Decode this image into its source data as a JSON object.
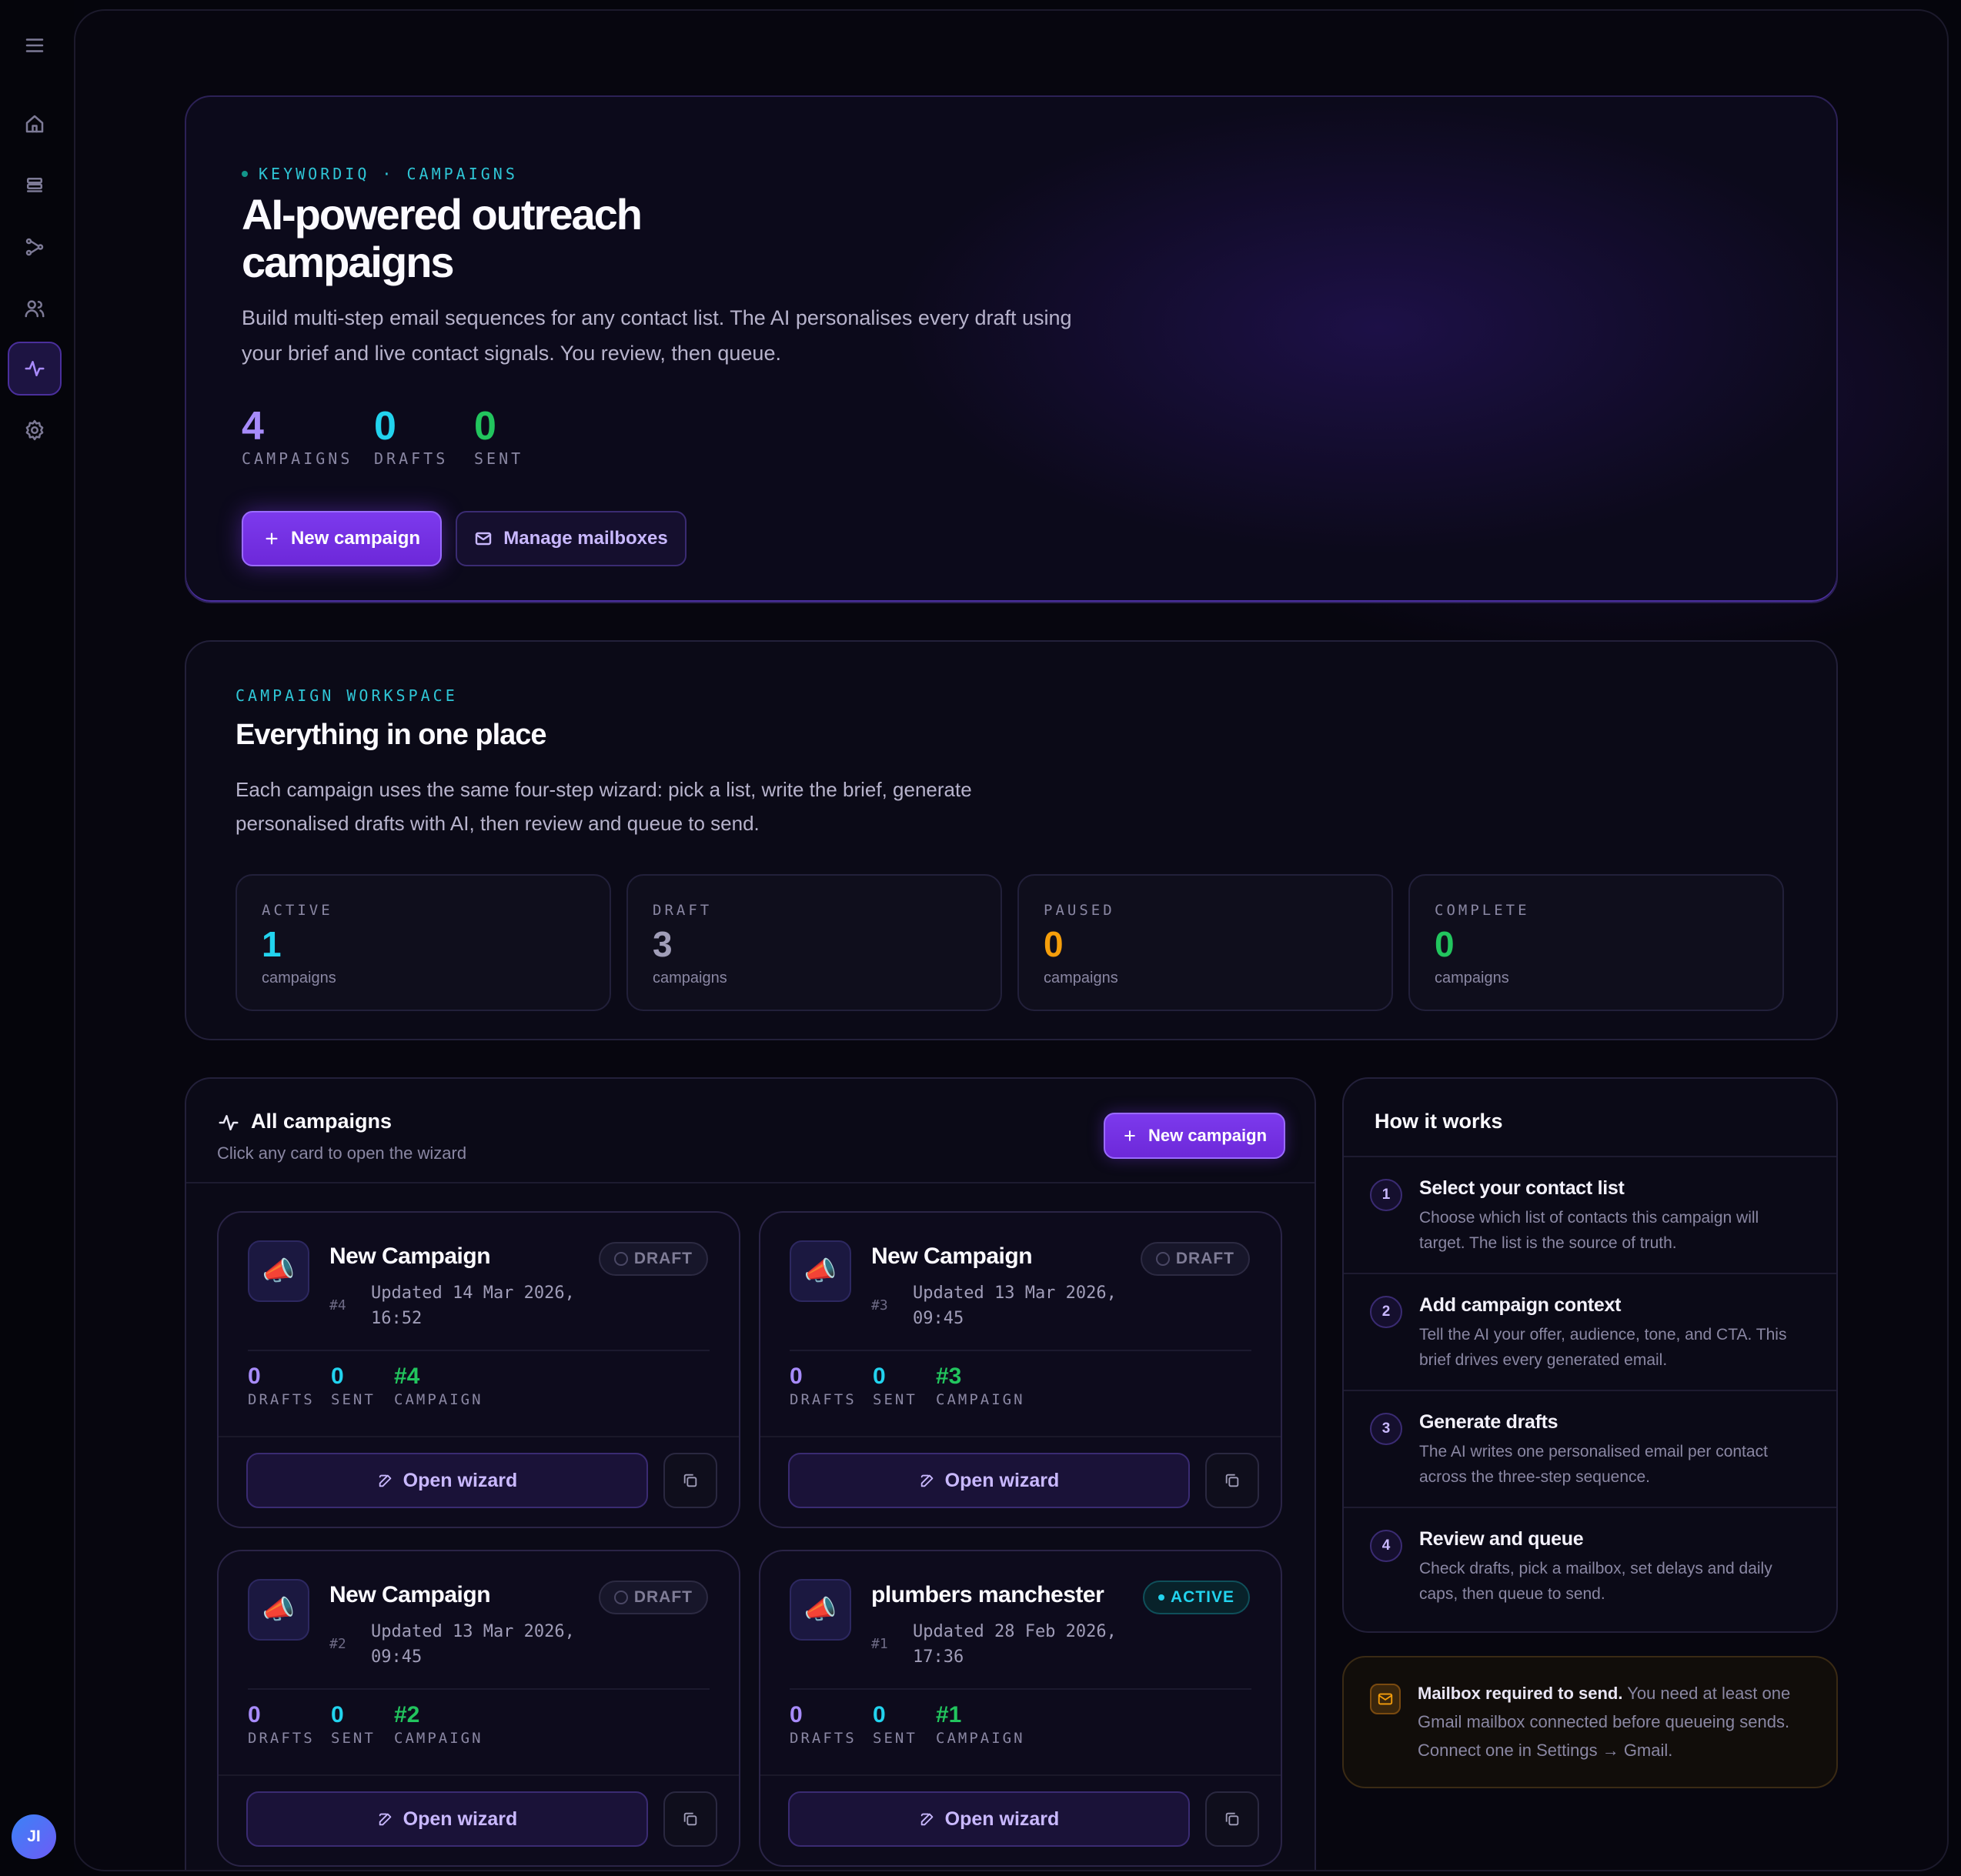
{
  "sidebar": {
    "items": [
      "menu",
      "home",
      "lists",
      "workflow",
      "contacts",
      "campaigns",
      "settings"
    ],
    "active": "campaigns",
    "avatar_initials": "JI"
  },
  "hero": {
    "eyebrow": "KEYWORDIQ · CAMPAIGNS",
    "title": "AI-powered outreach campaigns",
    "description": "Build multi-step email sequences for any contact list. The AI personalises every draft using your brief and live contact signals. You review, then queue.",
    "stats": [
      {
        "value": "4",
        "label": "CAMPAIGNS",
        "color": "#a78bfa"
      },
      {
        "value": "0",
        "label": "DRAFTS",
        "color": "#22d3ee"
      },
      {
        "value": "0",
        "label": "SENT",
        "color": "#22c55e"
      }
    ],
    "new_campaign_label": "New campaign",
    "manage_mailboxes_label": "Manage mailboxes"
  },
  "workspace": {
    "eyebrow": "CAMPAIGN WORKSPACE",
    "title": "Everything in one place",
    "description": "Each campaign uses the same four-step wizard: pick a list, write the brief, generate personalised drafts with AI, then review and queue to send.",
    "statuses": [
      {
        "label": "ACTIVE",
        "value": "1",
        "sub": "campaigns",
        "color": "#22d3ee"
      },
      {
        "label": "DRAFT",
        "value": "3",
        "sub": "campaigns",
        "color": "#a09db8"
      },
      {
        "label": "PAUSED",
        "value": "0",
        "sub": "campaigns",
        "color": "#f59e0b"
      },
      {
        "label": "COMPLETE",
        "value": "0",
        "sub": "campaigns",
        "color": "#22c55e"
      }
    ]
  },
  "campaigns": {
    "title": "All campaigns",
    "subtitle": "Click any card to open the wizard",
    "new_campaign_label": "New campaign",
    "open_wizard_label": "Open wizard",
    "metric_labels": {
      "drafts": "DRAFTS",
      "sent": "SENT",
      "campaign": "CAMPAIGN"
    },
    "items": [
      {
        "name": "New Campaign",
        "id": "#4",
        "updated": "Updated 14 Mar 2026, 16:52",
        "status": "DRAFT",
        "drafts": "0",
        "sent": "0",
        "campaign": "#4"
      },
      {
        "name": "New Campaign",
        "id": "#3",
        "updated": "Updated 13 Mar 2026, 09:45",
        "status": "DRAFT",
        "drafts": "0",
        "sent": "0",
        "campaign": "#3"
      },
      {
        "name": "New Campaign",
        "id": "#2",
        "updated": "Updated 13 Mar 2026, 09:45",
        "status": "DRAFT",
        "drafts": "0",
        "sent": "0",
        "campaign": "#2"
      },
      {
        "name": "plumbers manchester",
        "id": "#1",
        "updated": "Updated 28 Feb 2026, 17:36",
        "status": "ACTIVE",
        "drafts": "0",
        "sent": "0",
        "campaign": "#1"
      }
    ]
  },
  "how_it_works": {
    "title": "How it works",
    "steps": [
      {
        "n": "1",
        "title": "Select your contact list",
        "desc": "Choose which list of contacts this campaign will target. The list is the source of truth."
      },
      {
        "n": "2",
        "title": "Add campaign context",
        "desc": "Tell the AI your offer, audience, tone, and CTA. This brief drives every generated email."
      },
      {
        "n": "3",
        "title": "Generate drafts",
        "desc": "The AI writes one personalised email per contact across the three-step sequence."
      },
      {
        "n": "4",
        "title": "Review and queue",
        "desc": "Check drafts, pick a mailbox, set delays and daily caps, then queue to send."
      }
    ]
  },
  "notice": {
    "bold": "Mailbox required to send.",
    "text": " You need at least one Gmail mailbox connected before queueing sends. Connect one in Settings → Gmail."
  },
  "colors": {
    "accent": "#7c3aed",
    "cyan": "#22d3ee",
    "green": "#22c55e",
    "amber": "#f59e0b"
  }
}
